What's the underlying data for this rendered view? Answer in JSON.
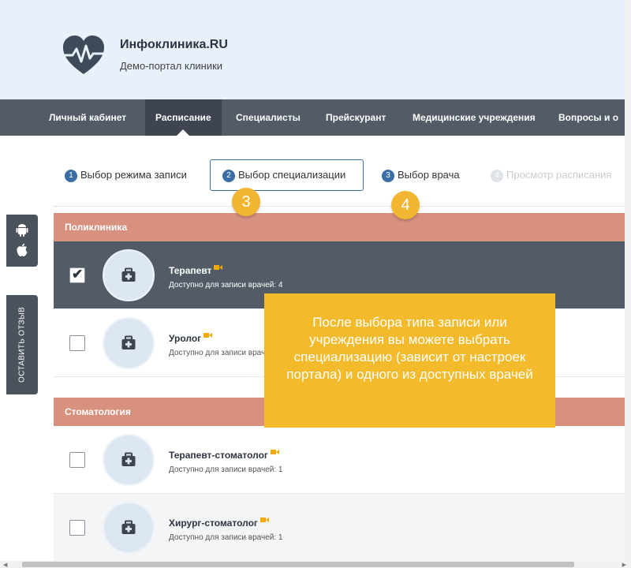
{
  "brand": {
    "name": "Инфоклиника.RU",
    "subtitle": "Демо-портал клиники"
  },
  "nav": {
    "items": [
      {
        "label": "Личный кабинет"
      },
      {
        "label": "Расписание",
        "active": true
      },
      {
        "label": "Специалисты"
      },
      {
        "label": "Прейскурант"
      },
      {
        "label": "Медицинские учреждения"
      },
      {
        "label": "Вопросы и о"
      }
    ]
  },
  "side": {
    "feedback_label": "ОСТАВИТЬ ОТЗЫВ"
  },
  "steps": [
    {
      "num": "1",
      "label": "Выбор режима записи"
    },
    {
      "num": "2",
      "label": "Выбор специализации",
      "current": true
    },
    {
      "num": "3",
      "label": "Выбор врача"
    },
    {
      "num": "4",
      "label": "Просмотр расписания",
      "disabled": true
    }
  ],
  "badges": [
    "3",
    "4"
  ],
  "groups": [
    {
      "title": "Поликлиника",
      "items": [
        {
          "name": "Терапевт",
          "available": "Доступно для записи врачей: 4",
          "checked": true
        },
        {
          "name": "Уролог",
          "available": "Доступно для записи врачей: 1",
          "checked": false
        }
      ]
    },
    {
      "title": "Стоматология",
      "items": [
        {
          "name": "Терапевт-стоматолог",
          "available": "Доступно для записи врачей: 1",
          "checked": false
        },
        {
          "name": "Хирург-стоматолог",
          "available": "Доступно для записи врачей: 1",
          "checked": false
        }
      ]
    }
  ],
  "callout": {
    "text": "После выбора типа записи или учреждения вы можете выбрать специализацию (зависит от настроек портала) и одного из доступных врачей"
  },
  "colors": {
    "header_bg": "#e8f0fa",
    "nav_bg": "#525b66",
    "group_bg": "#d8907f",
    "accent": "#3a6ea5",
    "callout_bg": "#f3ba2c",
    "video_icon": "#f2a900"
  },
  "icons": {
    "logo": "heart-pulse-icon",
    "android": "android-icon",
    "apple": "apple-icon",
    "specialty": "medical-kit-icon",
    "video": "video-camera-icon",
    "check": "checkmark-icon"
  }
}
